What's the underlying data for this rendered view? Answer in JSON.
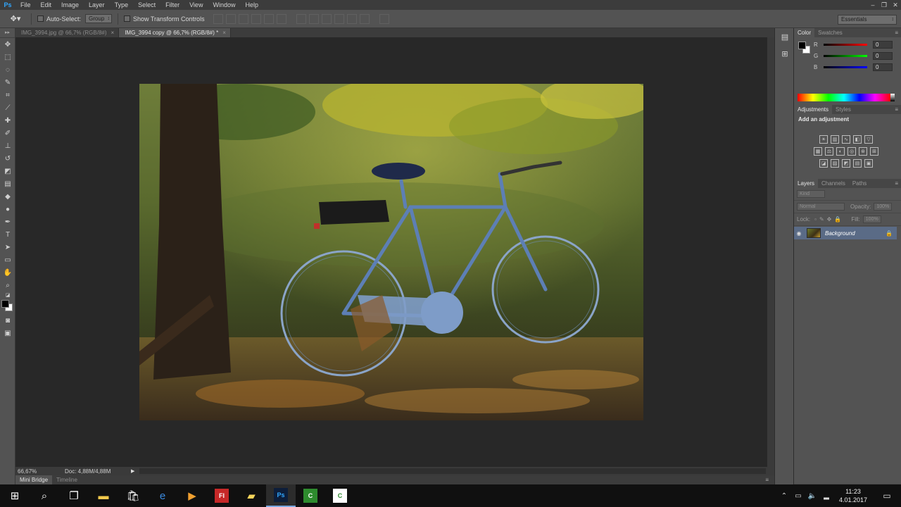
{
  "app": {
    "logo": "Ps",
    "menu": [
      "File",
      "Edit",
      "Image",
      "Layer",
      "Type",
      "Select",
      "Filter",
      "View",
      "Window",
      "Help"
    ],
    "window_controls": [
      "–",
      "❐",
      "✕"
    ]
  },
  "options_bar": {
    "auto_select_label": "Auto-Select:",
    "auto_select_value": "Group",
    "show_transform_label": "Show Transform Controls",
    "workspace": "Essentials"
  },
  "doc_tabs": [
    {
      "label": "IMG_3994.jpg @ 66,7% (RGB/8#)",
      "close": "×"
    },
    {
      "label": "IMG_3994 copy @ 66,7% (RGB/8#) *",
      "close": "×"
    }
  ],
  "status": {
    "zoom": "66,67%",
    "doc": "Doc: 4,88M/4,88M"
  },
  "bottom_tabs": [
    "Mini Bridge",
    "Timeline"
  ],
  "color_panel": {
    "tabs": [
      "Color",
      "Swatches"
    ],
    "channels": [
      {
        "name": "R",
        "value": "0",
        "color": "#d33"
      },
      {
        "name": "G",
        "value": "0",
        "color": "#3b3"
      },
      {
        "name": "B",
        "value": "0",
        "color": "#33d"
      }
    ]
  },
  "adjustments_panel": {
    "tabs": [
      "Adjustments",
      "Styles"
    ],
    "title": "Add an adjustment"
  },
  "layers_panel": {
    "tabs": [
      "Layers",
      "Channels",
      "Paths"
    ],
    "kind": "Kind",
    "blend_mode": "Normal",
    "opacity_label": "Opacity:",
    "opacity_value": "100%",
    "lock_label": "Lock:",
    "fill_label": "Fill:",
    "fill_value": "100%",
    "layers": [
      {
        "name": "Background"
      }
    ]
  },
  "taskbar": {
    "time": "11:23",
    "date": "4.01.2017",
    "apps": [
      {
        "name": "ps",
        "label": "Ps",
        "bg": "#0d1e3a",
        "fg": "#31a8ff"
      },
      {
        "name": "green-app",
        "label": "C",
        "bg": "#2e8b2e",
        "fg": "#ffffff"
      },
      {
        "name": "camtasia",
        "label": "C",
        "bg": "#ffffff",
        "fg": "#2e8b2e"
      }
    ]
  }
}
